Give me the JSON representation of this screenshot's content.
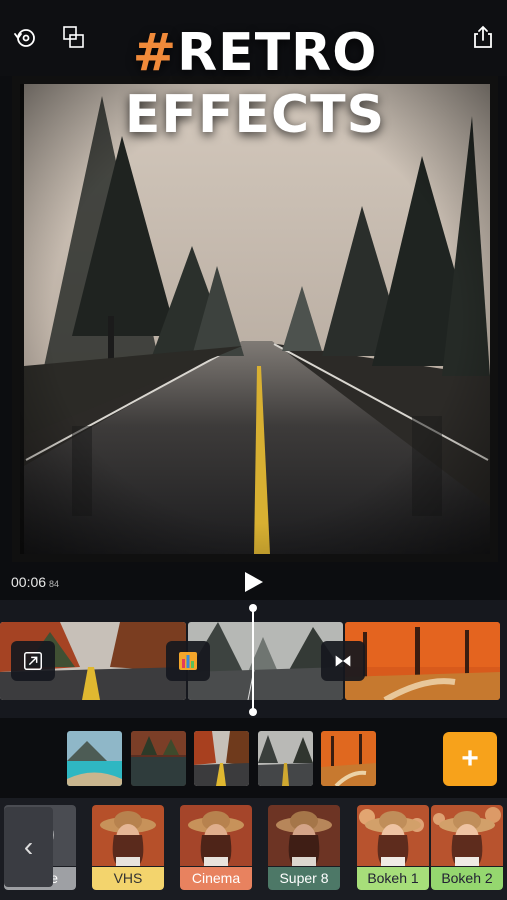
{
  "header": {
    "title_hash": "#",
    "title_line1": "RETRO",
    "title_line2": "EFFECTS",
    "icons": [
      "rotate-icon",
      "layout-icon",
      "share-icon"
    ]
  },
  "player": {
    "time": "00:06",
    "frames": "84"
  },
  "timeline": {
    "clips": [
      "road-autumn",
      "foggy-forest-road",
      "autumn-forest-path"
    ],
    "transitions": [
      "crop-icon",
      "effects-icon",
      "bowtie-transition-icon"
    ]
  },
  "media_bin": {
    "thumbnails": [
      "lake",
      "lakeside-trees",
      "autumn-road",
      "foggy-road",
      "autumn-path"
    ],
    "add_label": "+"
  },
  "effects": {
    "back_label": "‹",
    "items": [
      {
        "label": "e",
        "color": "#9ea0a4"
      },
      {
        "label": "VHS",
        "color": "#f3d46d"
      },
      {
        "label": "Cinema",
        "color": "#e8825f"
      },
      {
        "label": "Super 8",
        "color": "#4d7867"
      },
      {
        "label": "Bokeh 1",
        "color": "#a7de7a"
      },
      {
        "label": "Bokeh 2",
        "color": "#95d76f"
      }
    ]
  },
  "colors": {
    "accent": "#f7a21b",
    "title_hash": "#f08a3a"
  }
}
